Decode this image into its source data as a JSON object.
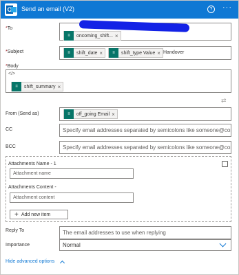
{
  "header": {
    "title": "Send an email (V2)",
    "help_symbol": "?",
    "more_symbol": "···"
  },
  "fields": {
    "to": {
      "required_mark": "*",
      "label": "To",
      "tokens": [
        "oncoming_shift..."
      ]
    },
    "subject": {
      "required_mark": "*",
      "label": "Subject",
      "tokens": [
        "shift_date",
        "shift_type Value"
      ],
      "text": "Handover"
    },
    "body": {
      "required_mark": "*",
      "label": "Body",
      "code_symbol": "</>",
      "tokens": [
        "shift_summary"
      ]
    },
    "from": {
      "label": "From (Send as)",
      "tokens": [
        "off_going Email"
      ]
    },
    "cc": {
      "label": "CC",
      "placeholder": "Specify email addresses separated by semicolons like someone@contoso.com"
    },
    "bcc": {
      "label": "BCC",
      "placeholder": "Specify email addresses separated by semicolons like someone@contoso.com"
    }
  },
  "attachments": {
    "name_label": "Attachments Name - 1",
    "name_placeholder": "Attachment name",
    "content_label": "Attachments Content -",
    "content_placeholder": "Attachment content",
    "add_label": "Add new item"
  },
  "reply_to": {
    "label": "Reply To",
    "placeholder": "The email addresses to use when replying"
  },
  "importance": {
    "label": "Importance",
    "value": "Normal"
  },
  "footer": {
    "hide_label": "Hide advanced options"
  },
  "token_x": "×",
  "colors": {
    "header": "#0f78d4",
    "token_icon": "#077568",
    "redaction": "#1322e6"
  }
}
